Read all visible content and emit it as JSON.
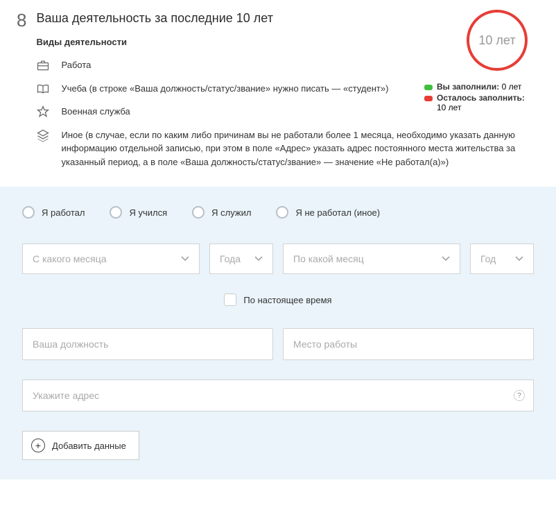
{
  "step_number": "8",
  "title": "Ваша деятельность за последние 10 лет",
  "subtitle": "Виды деятельности",
  "ring_label": "10 лет",
  "legend": {
    "filled_label": "Вы заполнили:",
    "filled_value": "0 лет",
    "remaining_label": "Осталось заполнить:",
    "remaining_value": "10 лет"
  },
  "types": {
    "work": "Работа",
    "study": "Учеба (в строке «Ваша должность/статус/звание» нужно писать — «студент»)",
    "military": "Военная служба",
    "other": "Иное (в случае, если по каким либо причинам вы не работали более 1 месяца, необходимо указать данную информацию отдельной записью, при этом в поле «Адрес» указать адрес постоянного места жительства за указанный период, а в поле «Ваша должность/статус/звание» — значение «Не работал(а)»)"
  },
  "form": {
    "radios": {
      "worked": "Я работал",
      "studied": "Я учился",
      "served": "Я служил",
      "none": "Я не работал (иное)"
    },
    "from_month": "С какого месяца",
    "from_year": "Года",
    "to_month": "По какой месяц",
    "to_year": "Год",
    "present": "По настоящее время",
    "position": "Ваша должность",
    "workplace": "Место работы",
    "address": "Укажите адрес",
    "help": "?",
    "add_button": "Добавить данные"
  }
}
